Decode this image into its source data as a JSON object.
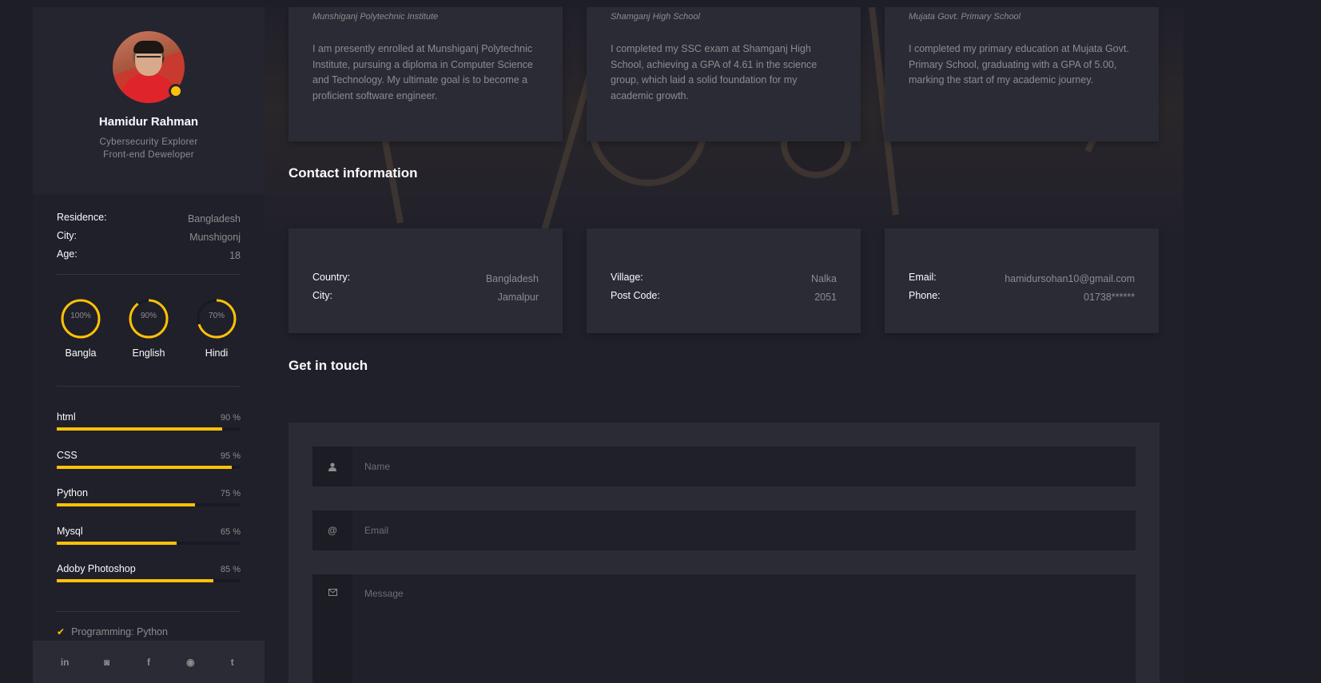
{
  "profile": {
    "name": "Hamidur Rahman",
    "roles": [
      "Cybersecurity Explorer",
      "Front-end Deweloper"
    ],
    "accent": "#ffc107"
  },
  "personal_info": [
    {
      "key": "Residence:",
      "value": "Bangladesh"
    },
    {
      "key": "City:",
      "value": "Munshigonj"
    },
    {
      "key": "Age:",
      "value": "18"
    }
  ],
  "languages": [
    {
      "label": "Bangla",
      "percent_text": "100%",
      "percent": 100
    },
    {
      "label": "English",
      "percent_text": "90%",
      "percent": 90
    },
    {
      "label": "Hindi",
      "percent_text": "70%",
      "percent": 70
    }
  ],
  "skills": [
    {
      "name": "html",
      "percent_text": "90 %",
      "percent": 90
    },
    {
      "name": "CSS",
      "percent_text": "95 %",
      "percent": 95
    },
    {
      "name": "Python",
      "percent_text": "75 %",
      "percent": 75
    },
    {
      "name": "Mysql",
      "percent_text": "65 %",
      "percent": 65
    },
    {
      "name": "Adoby Photoshop",
      "percent_text": "85 %",
      "percent": 85
    }
  ],
  "knowledge": [
    "Programming: Python"
  ],
  "social": [
    {
      "name": "linkedin",
      "glyph": "in"
    },
    {
      "name": "discord",
      "glyph": "◙"
    },
    {
      "name": "facebook",
      "glyph": "f"
    },
    {
      "name": "github",
      "glyph": "◉"
    },
    {
      "name": "twitter",
      "glyph": "t"
    }
  ],
  "education": [
    {
      "school": "Munshiganj Polytechnic Institute",
      "description": "I am presently enrolled at Munshiganj Polytechnic Institute, pursuing a diploma in Computer Science and Technology. My ultimate goal is to become a proficient software engineer."
    },
    {
      "school": "Shamganj High School",
      "description": "I completed my SSC exam at Shamganj High School, achieving a GPA of 4.61 in the science group, which laid a solid foundation for my academic growth."
    },
    {
      "school": "Mujata Govt. Primary School",
      "description": "I completed my primary education at Mujata Govt. Primary School, graduating with a GPA of 5.00, marking the start of my academic journey."
    }
  ],
  "contact": {
    "title": "Contact information",
    "cards": [
      [
        {
          "key": "Country:",
          "value": "Bangladesh"
        },
        {
          "key": "City:",
          "value": "Jamalpur"
        }
      ],
      [
        {
          "key": "Village:",
          "value": "Nalka"
        },
        {
          "key": "Post Code:",
          "value": "2051"
        }
      ],
      [
        {
          "key": "Email:",
          "value": "hamidursohan10@gmail.com"
        },
        {
          "key": "Phone:",
          "value": "01738******"
        }
      ]
    ]
  },
  "get_in_touch": {
    "title": "Get in touch",
    "name_placeholder": "Name",
    "email_placeholder": "Email",
    "message_placeholder": "Message",
    "name_icon": "user-icon",
    "email_icon": "at-icon",
    "message_icon": "envelope-icon"
  }
}
